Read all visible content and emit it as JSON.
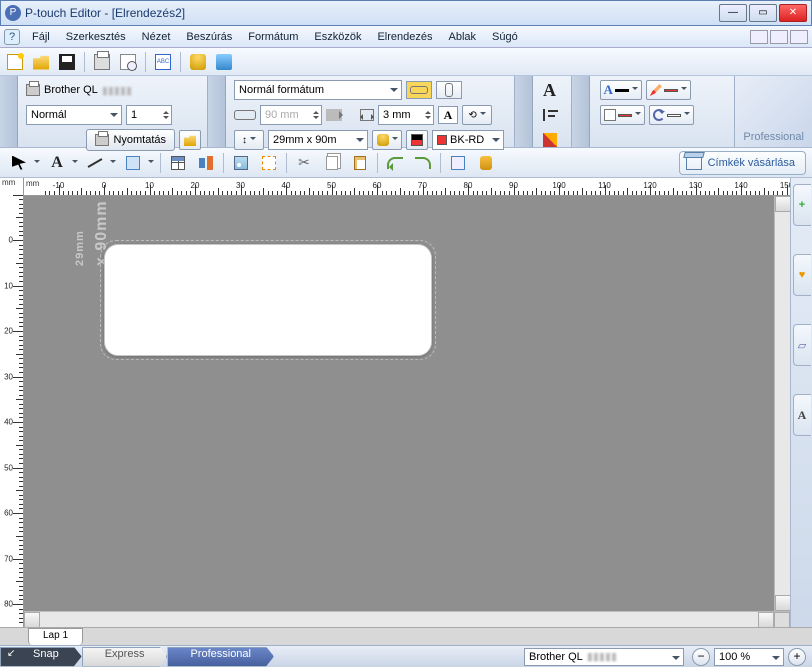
{
  "window": {
    "title": "P-touch Editor - [Elrendezés2]"
  },
  "menu": {
    "file": "Fájl",
    "edit": "Szerkesztés",
    "view": "Nézet",
    "insert": "Beszúrás",
    "format": "Formátum",
    "tools": "Eszközök",
    "layout": "Elrendezés",
    "window": "Ablak",
    "help": "Súgó"
  },
  "toolbar": {
    "abc": "ABC"
  },
  "print_panel": {
    "printer": "Brother QL",
    "copies_mode": "Normál",
    "copies": "1",
    "print_btn": "Nyomtatás"
  },
  "paper_panel": {
    "format": "Normál formátum",
    "length": "90 mm",
    "margin": "3 mm",
    "media": "29mm x 90m",
    "color": "BK-RD"
  },
  "buy_labels": "Címkék vásárlása",
  "canvas": {
    "label_size_a": "29mm",
    "label_size_b": "x 90mm"
  },
  "sheet_tab": "Lap 1",
  "status": {
    "snap": "Snap",
    "express": "Express",
    "professional": "Professional",
    "printer": "Brother QL",
    "zoom": "100 %"
  },
  "brand": "Professional",
  "ruler_unit": "mm"
}
